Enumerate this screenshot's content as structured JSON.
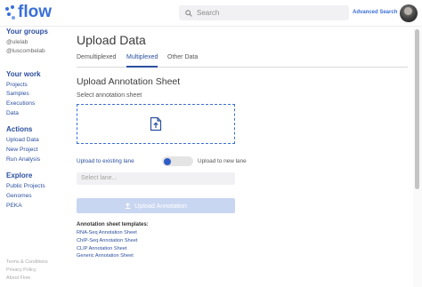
{
  "header": {
    "logo_text": "flow",
    "search_placeholder": "Search",
    "advanced_search": "Advanced Search"
  },
  "sidebar": {
    "groups_heading": "Your groups",
    "groups": [
      "@ulelab",
      "@luscombelab"
    ],
    "work_heading": "Your work",
    "work_items": [
      "Projects",
      "Samples",
      "Executions",
      "Data"
    ],
    "actions_heading": "Actions",
    "action_items": [
      "Upload Data",
      "New Project",
      "Run Analysis"
    ],
    "explore_heading": "Explore",
    "explore_items": [
      "Public Projects",
      "Genomes",
      "PEKA"
    ],
    "footer_links": [
      "Terms & Conditions",
      "Privacy Policy",
      "About Flow"
    ]
  },
  "main": {
    "page_title": "Upload Data",
    "tabs": [
      "Demultiplexed",
      "Multiplexed",
      "Other Data"
    ],
    "active_tab": "Multiplexed",
    "section_title": "Upload Annotation Sheet",
    "select_label": "Select annotation sheet",
    "lane_toggle_left": "Upload to existing lane",
    "lane_toggle_right": "Upload to new lane",
    "lane_placeholder": "Select lane...",
    "upload_button": "Upload Annotation",
    "templates_heading": "Annotation sheet templates:",
    "templates": [
      "RNA-Seq Annotation Sheet",
      "ChIP-Seq Annotation Sheet",
      "CLIP Annotation Sheet",
      "Generic Annotation Sheet"
    ]
  },
  "colors": {
    "accent": "#3a6fd8",
    "link": "#2b4f9e",
    "button_disabled": "#c9d6f1"
  },
  "icons": [
    "flow-logo-icon",
    "search-icon",
    "file-upload-icon",
    "upload-icon"
  ]
}
